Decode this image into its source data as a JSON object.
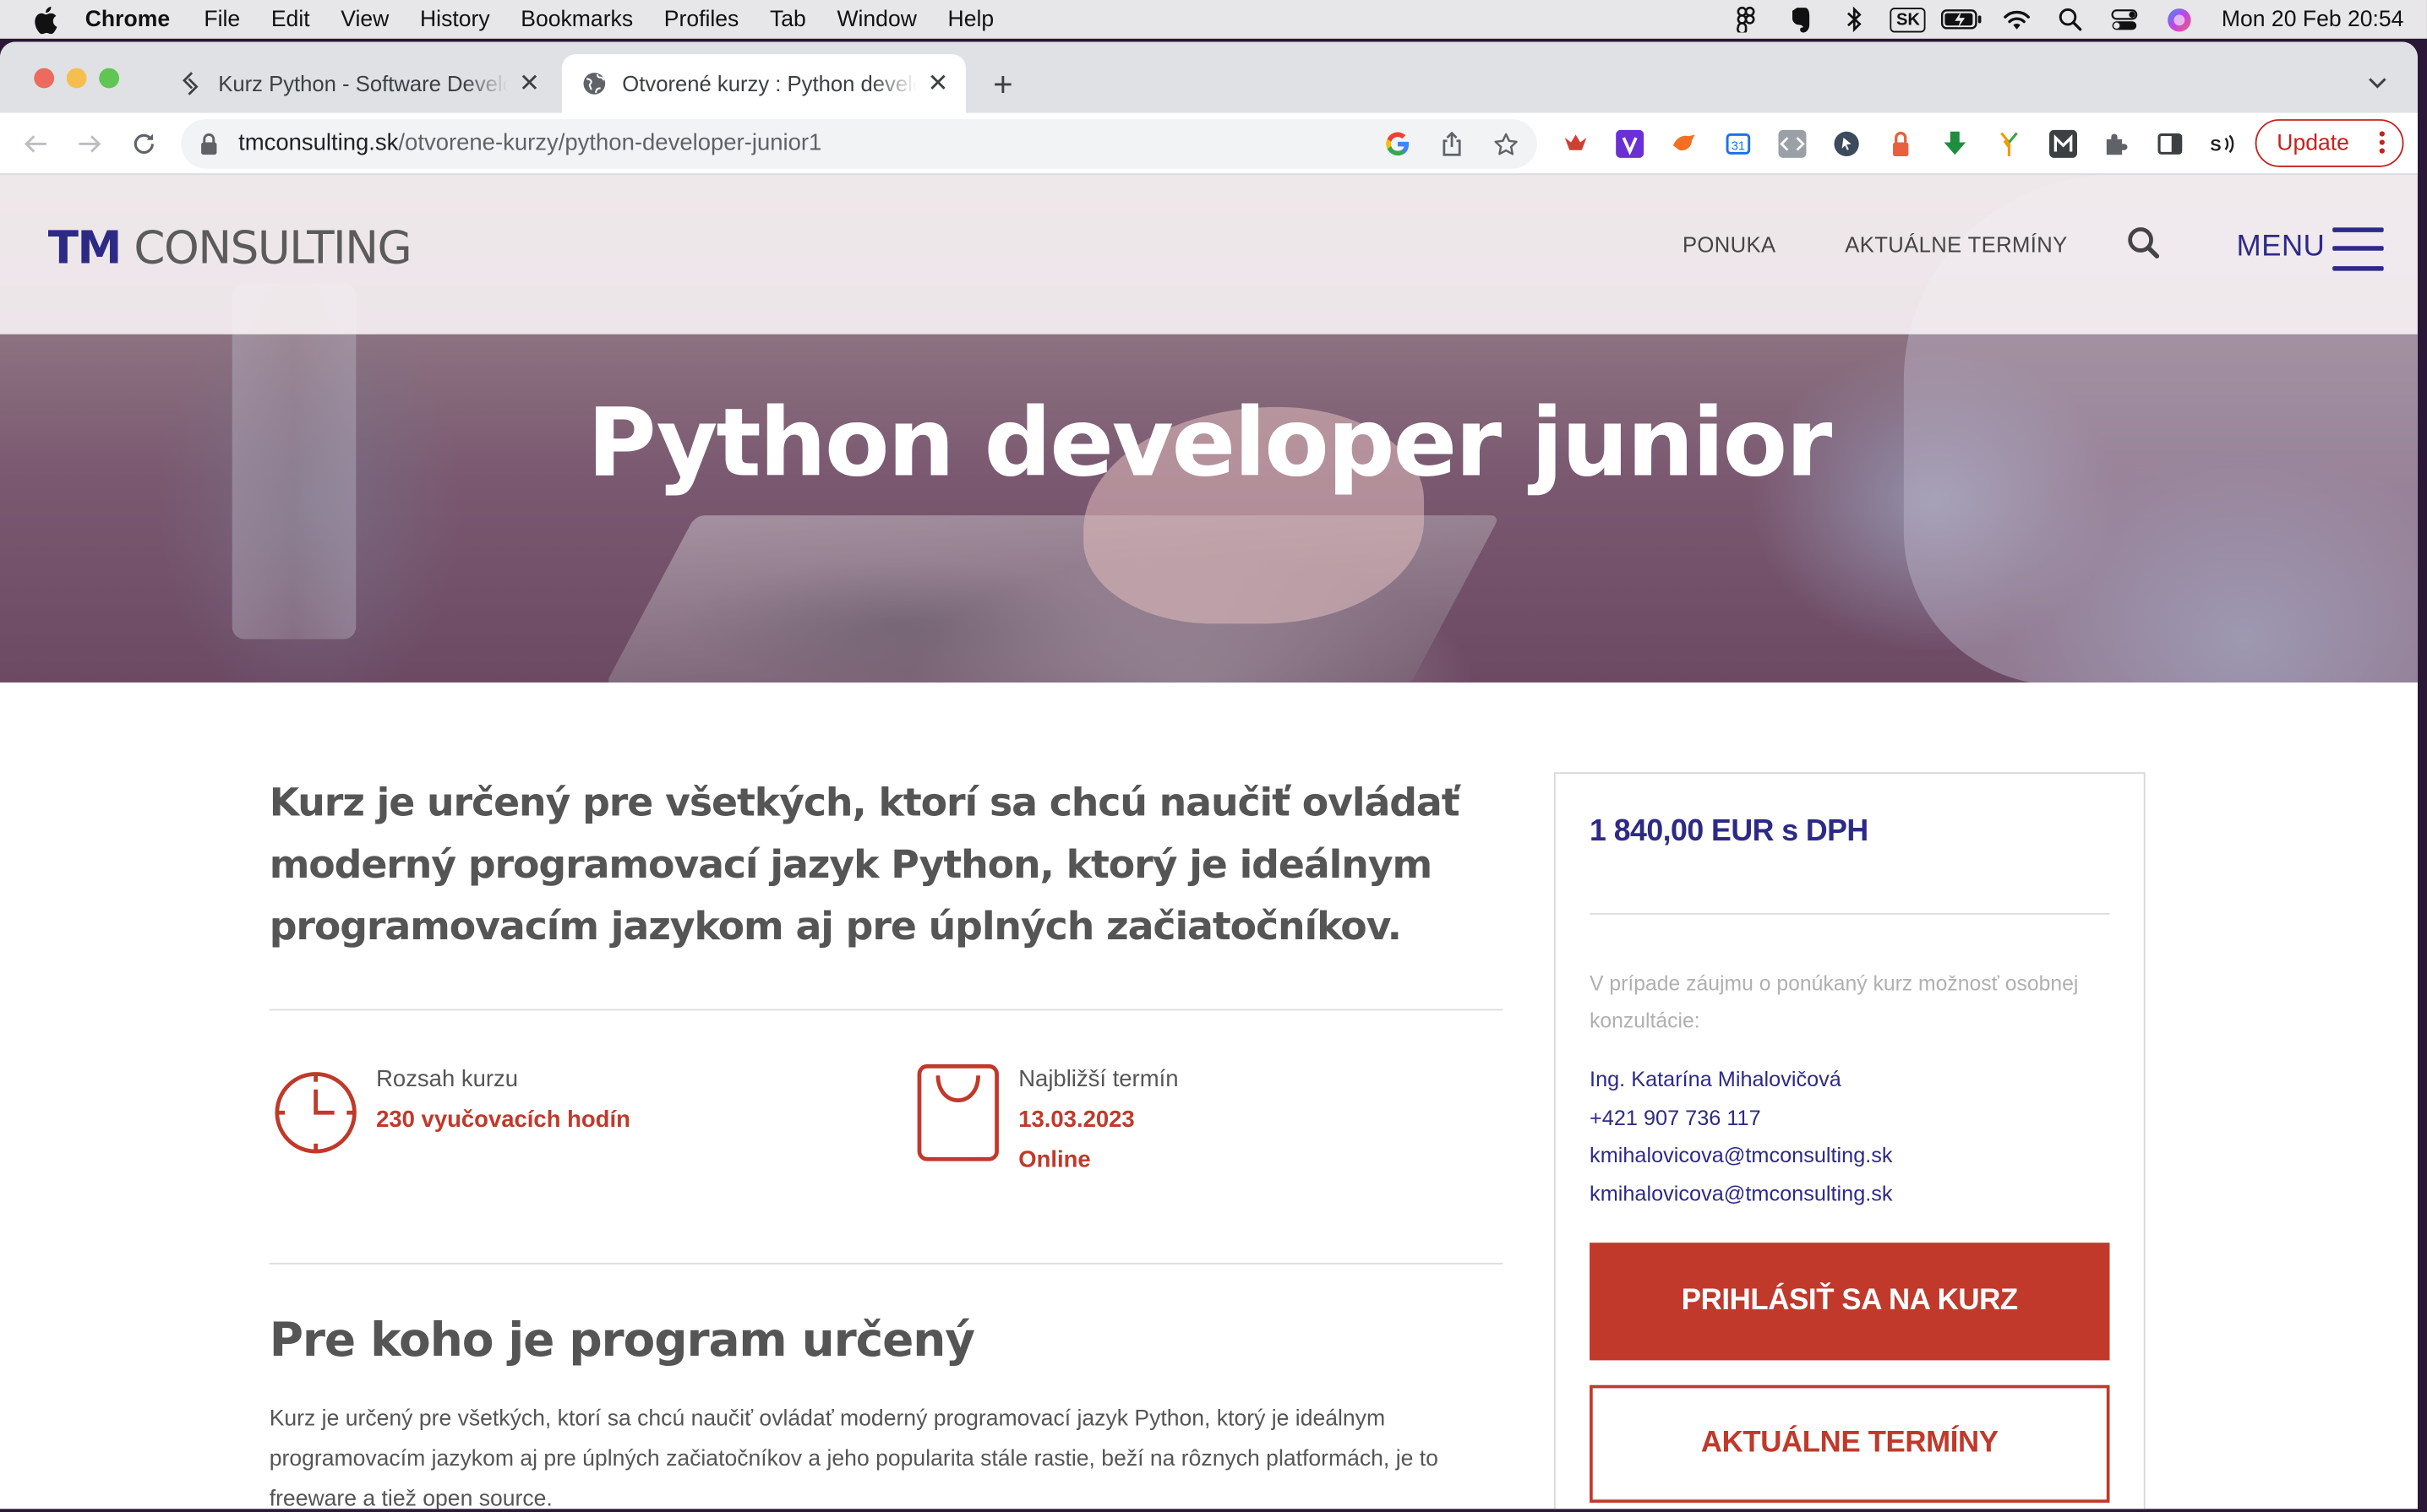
{
  "menubar": {
    "app": "Chrome",
    "items": [
      "File",
      "Edit",
      "View",
      "History",
      "Bookmarks",
      "Profiles",
      "Tab",
      "Window",
      "Help"
    ],
    "keyboard_layout": "SK",
    "clock": "Mon 20 Feb  20:54"
  },
  "tabs": [
    {
      "title": "Kurz Python - Software Develo",
      "icon": "link-icon",
      "active": false
    },
    {
      "title": "Otvorené kurzy : Python develo",
      "icon": "globe-icon",
      "active": true
    }
  ],
  "address_bar": {
    "domain": "tmconsulting.sk",
    "path": "/otvorene-kurzy/python-developer-junior1"
  },
  "update_button": "Update",
  "site": {
    "logo_tm": "TM",
    "logo_rest": " CONSULTING",
    "nav": [
      "PONUKA",
      "AKTUÁLNE TERMÍNY"
    ],
    "menu_label": "MENU",
    "hero_title": "Python developer junior",
    "lead": "Kurz je určený pre všetkých, ktorí sa chcú naučiť ovládať moderný programovací jazyk Python, ktorý je ideálnym programovacím jazykom aj pre úplných začiatočníkov.",
    "scope": {
      "label": "Rozsah kurzu",
      "value": "230 vyučovacích hodín"
    },
    "next_date": {
      "label": "Najbližší termín",
      "date": "13.03.2023",
      "mode": "Online"
    },
    "section_title": "Pre koho je program určený",
    "section_text": "Kurz je určený pre všetkých, ktorí sa chcú naučiť ovládať moderný programovací jazyk Python, ktorý je ideálnym programovacím jazykom aj pre úplných začiatočníkov a jeho popularita stále rastie, beží na rôznych platformách, je to freeware a tiež open source."
  },
  "sidebox": {
    "price": "1 840,00 EUR s DPH",
    "note": "V prípade záujmu o ponúkaný kurz možnosť osobnej konzultácie:",
    "contact_name": "Ing. Katarína Mihalovičová",
    "contact_phone": "+421 907 736 117",
    "contact_email_1": "kmihalovicova@tmconsulting.sk",
    "contact_email_2": "kmihalovicova@tmconsulting.sk",
    "register_button": "PRIHLÁSIŤ SA NA KURZ",
    "dates_button": "AKTUÁLNE TERMÍNY"
  },
  "colors": {
    "brand_blue": "#2d2a86",
    "accent_red": "#c0392b",
    "text_gray": "#555555"
  }
}
